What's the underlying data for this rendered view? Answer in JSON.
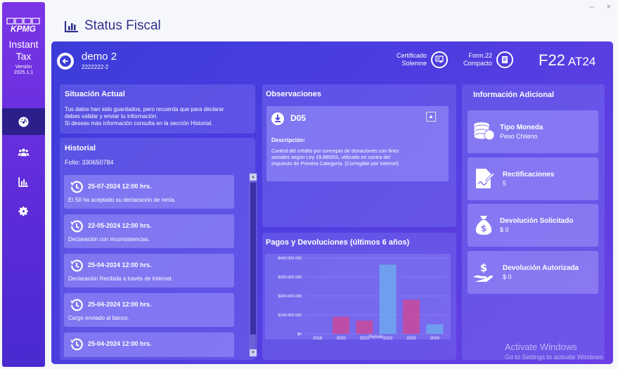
{
  "window": {
    "minimize": "–",
    "close": "×"
  },
  "sidebar": {
    "logo": "KPMG",
    "brand_line1": "Instant",
    "brand_line2": "Tax",
    "version_label": "Versión",
    "version": "2025.1.1",
    "items": [
      {
        "icon": "dashboard-icon",
        "active": true
      },
      {
        "icon": "users-icon",
        "active": false
      },
      {
        "icon": "chart-icon",
        "active": false
      },
      {
        "icon": "settings-icon",
        "active": false
      }
    ]
  },
  "header": {
    "title": "Status Fiscal"
  },
  "taxpayer": {
    "name": "demo 2",
    "rut": "2222222-2"
  },
  "actions": {
    "certificado_line1": "Certificado",
    "certificado_line2": "Solemne",
    "form_line1": "Form.22",
    "form_line2": "Compacto"
  },
  "form": {
    "code": "F22",
    "year": "AT24"
  },
  "situacion": {
    "title": "Situación Actual",
    "text_line1": "Tus datos han sido guardados, pero recuerda que para declarar",
    "text_line2": "debes validar y enviar tu información.",
    "text_line3": "Si deseas más información consulta en la sección Historial."
  },
  "historial": {
    "title": "Historial",
    "folio": "Folio: 330650784",
    "items": [
      {
        "date": "25-07-2024 12:00 hrs.",
        "desc": "El SII ha aceptado su declaración de renta."
      },
      {
        "date": "22-05-2024 12:00 hrs.",
        "desc": "Declaración con inconsistencias."
      },
      {
        "date": "25-04-2024 12:00 hrs.",
        "desc": "Declaración Recibida a través de Internet."
      },
      {
        "date": "25-04-2024 12:00 hrs.",
        "desc": "Cargo enviado al banco."
      },
      {
        "date": "25-04-2024 12:00 hrs.",
        "desc": ""
      }
    ]
  },
  "observaciones": {
    "title": "Observaciones",
    "code": "D05",
    "desc_label": "Descripción:",
    "desc_line1": "Control del crédito por concepto de donaciones con fines",
    "desc_line2": "sociales según Ley 19.885/03, utilizado en contra del",
    "desc_line3": "Impuesto de Primera Categoría. (Corregible por Internet)"
  },
  "pagos": {
    "title": "Pagos y Devoluciones (últimos 6 años)"
  },
  "chart_data": {
    "type": "bar",
    "title": "",
    "xlabel": "Periodo",
    "ylabel": "",
    "categories": [
      "2019",
      "2020",
      "2021",
      "2022",
      "2023",
      "2024"
    ],
    "values": [
      0,
      90000000,
      70000000,
      365000000,
      180000000,
      50000000
    ],
    "colors": [
      "#c94a9a",
      "#c94a9a",
      "#c94a9a",
      "#6fa8ee",
      "#c94a9a",
      "#6fa8ee"
    ],
    "ylim": [
      0,
      400000000
    ],
    "yticks": [
      0,
      100000000,
      200000000,
      300000000,
      400000000
    ],
    "ytick_labels": [
      "$0",
      "$100.000.000",
      "$200.000.000",
      "$300.000.000",
      "$400.000.000"
    ],
    "grid": true
  },
  "info": {
    "title": "Información Adicional",
    "cards": [
      {
        "icon": "coins-icon",
        "title": "Tipo Moneda",
        "value": "Peso Chileno"
      },
      {
        "icon": "signature-icon",
        "title": "Rectificaciones",
        "value": "5"
      },
      {
        "icon": "money-bag-icon",
        "title": "Devolución Solicitado",
        "value": "$ 0"
      },
      {
        "icon": "hand-dollar-icon",
        "title": "Devolución Autorizada",
        "value": "$ 0"
      }
    ]
  },
  "watermark": {
    "line1": "Activate Windows",
    "line2": "Go to Settings to activate Windows."
  }
}
